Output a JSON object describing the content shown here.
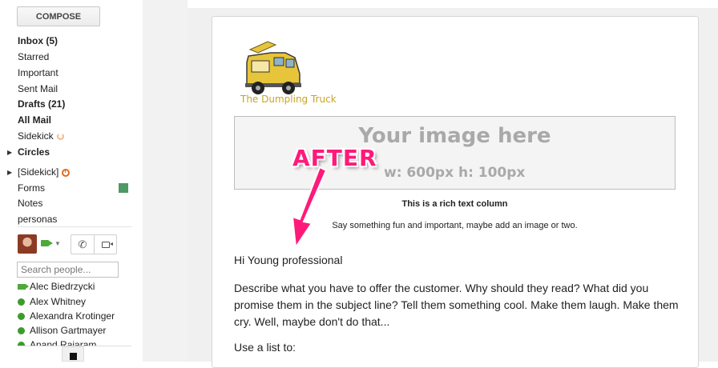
{
  "sidebar": {
    "compose_label": "COMPOSE",
    "nav": {
      "inbox": "Inbox (5)",
      "starred": "Starred",
      "important": "Important",
      "sent": "Sent Mail",
      "drafts": "Drafts (21)",
      "all_mail": "All Mail",
      "sidekick": "Sidekick",
      "circles": "Circles",
      "sidekick_label": "[Sidekick]",
      "forms": "Forms",
      "notes": "Notes",
      "personas": "personas"
    },
    "forms_color": "#4e9a63",
    "search_placeholder": "Search people...",
    "contacts": [
      {
        "name": "Alec Biedrzycki",
        "status": "video"
      },
      {
        "name": "Alex Whitney",
        "status": "online"
      },
      {
        "name": "Alexandra Krotinger",
        "status": "online"
      },
      {
        "name": "Allison Gartmayer",
        "status": "online"
      },
      {
        "name": "Anand Rajaram",
        "status": "online"
      }
    ]
  },
  "email": {
    "logo_text": "The Dumpling Truck",
    "placeholder_title": "Your image here",
    "placeholder_size": "w: 600px  h: 100px",
    "annotation": "AFTER",
    "rich_title": "This is a rich text column",
    "rich_subtitle": "Say something fun and important, maybe add an image or two.",
    "greeting": "Hi Young professional",
    "body": "Describe what you have to offer the customer. Why should they read? What did you promise them in the subject line? Tell them something cool. Make them laugh. Make them cry. Well, maybe don't do that...",
    "list_intro": "Use a list to:"
  },
  "colors": {
    "annotation": "#ff1a7a",
    "online": "#3c9c2b",
    "logo_yellow": "#e7c53a"
  }
}
